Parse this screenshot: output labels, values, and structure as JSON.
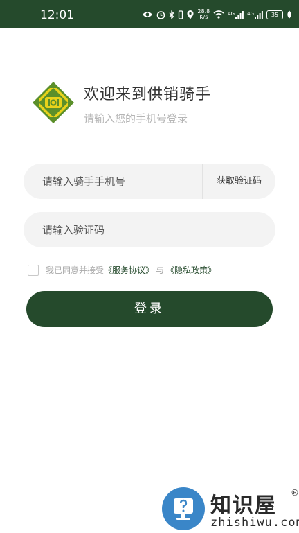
{
  "status_bar": {
    "time": "12:01",
    "network_speed_value": "28.8",
    "network_speed_unit": "K/s",
    "signal_1_label": "4G",
    "signal_2_label": "4G",
    "battery": "35",
    "icons": [
      "eye-icon",
      "alarm-icon",
      "bluetooth-icon",
      "vibrate-icon",
      "location-icon",
      "wifi-icon",
      "signal-icon",
      "signal-icon",
      "battery-icon",
      "leaf-icon"
    ]
  },
  "header": {
    "title": "欢迎来到供销骑手",
    "subtitle": "请输入您的手机号登录",
    "logo_icon": "co-op-logo-icon"
  },
  "form": {
    "phone_placeholder": "请输入骑手手机号",
    "phone_value": "",
    "get_code_label": "获取验证码",
    "code_placeholder": "请输入验证码",
    "code_value": "",
    "agree_checked": false,
    "agree_prefix": "我已同意并接受",
    "service_agreement": "《服务协议》",
    "agree_and": "与",
    "privacy_policy": "《隐私政策》",
    "login_label": "登录"
  },
  "watermark": {
    "brand": "知识屋",
    "registered": "®",
    "domain": "zhishiwu.com",
    "icon": "question-monitor-icon"
  },
  "colors": {
    "primary": "#254a2c",
    "logo_green": "#5b8f2a",
    "logo_yellow": "#e8d21a",
    "field_bg": "#f3f3f3",
    "watermark_blue": "#3a86c8"
  }
}
